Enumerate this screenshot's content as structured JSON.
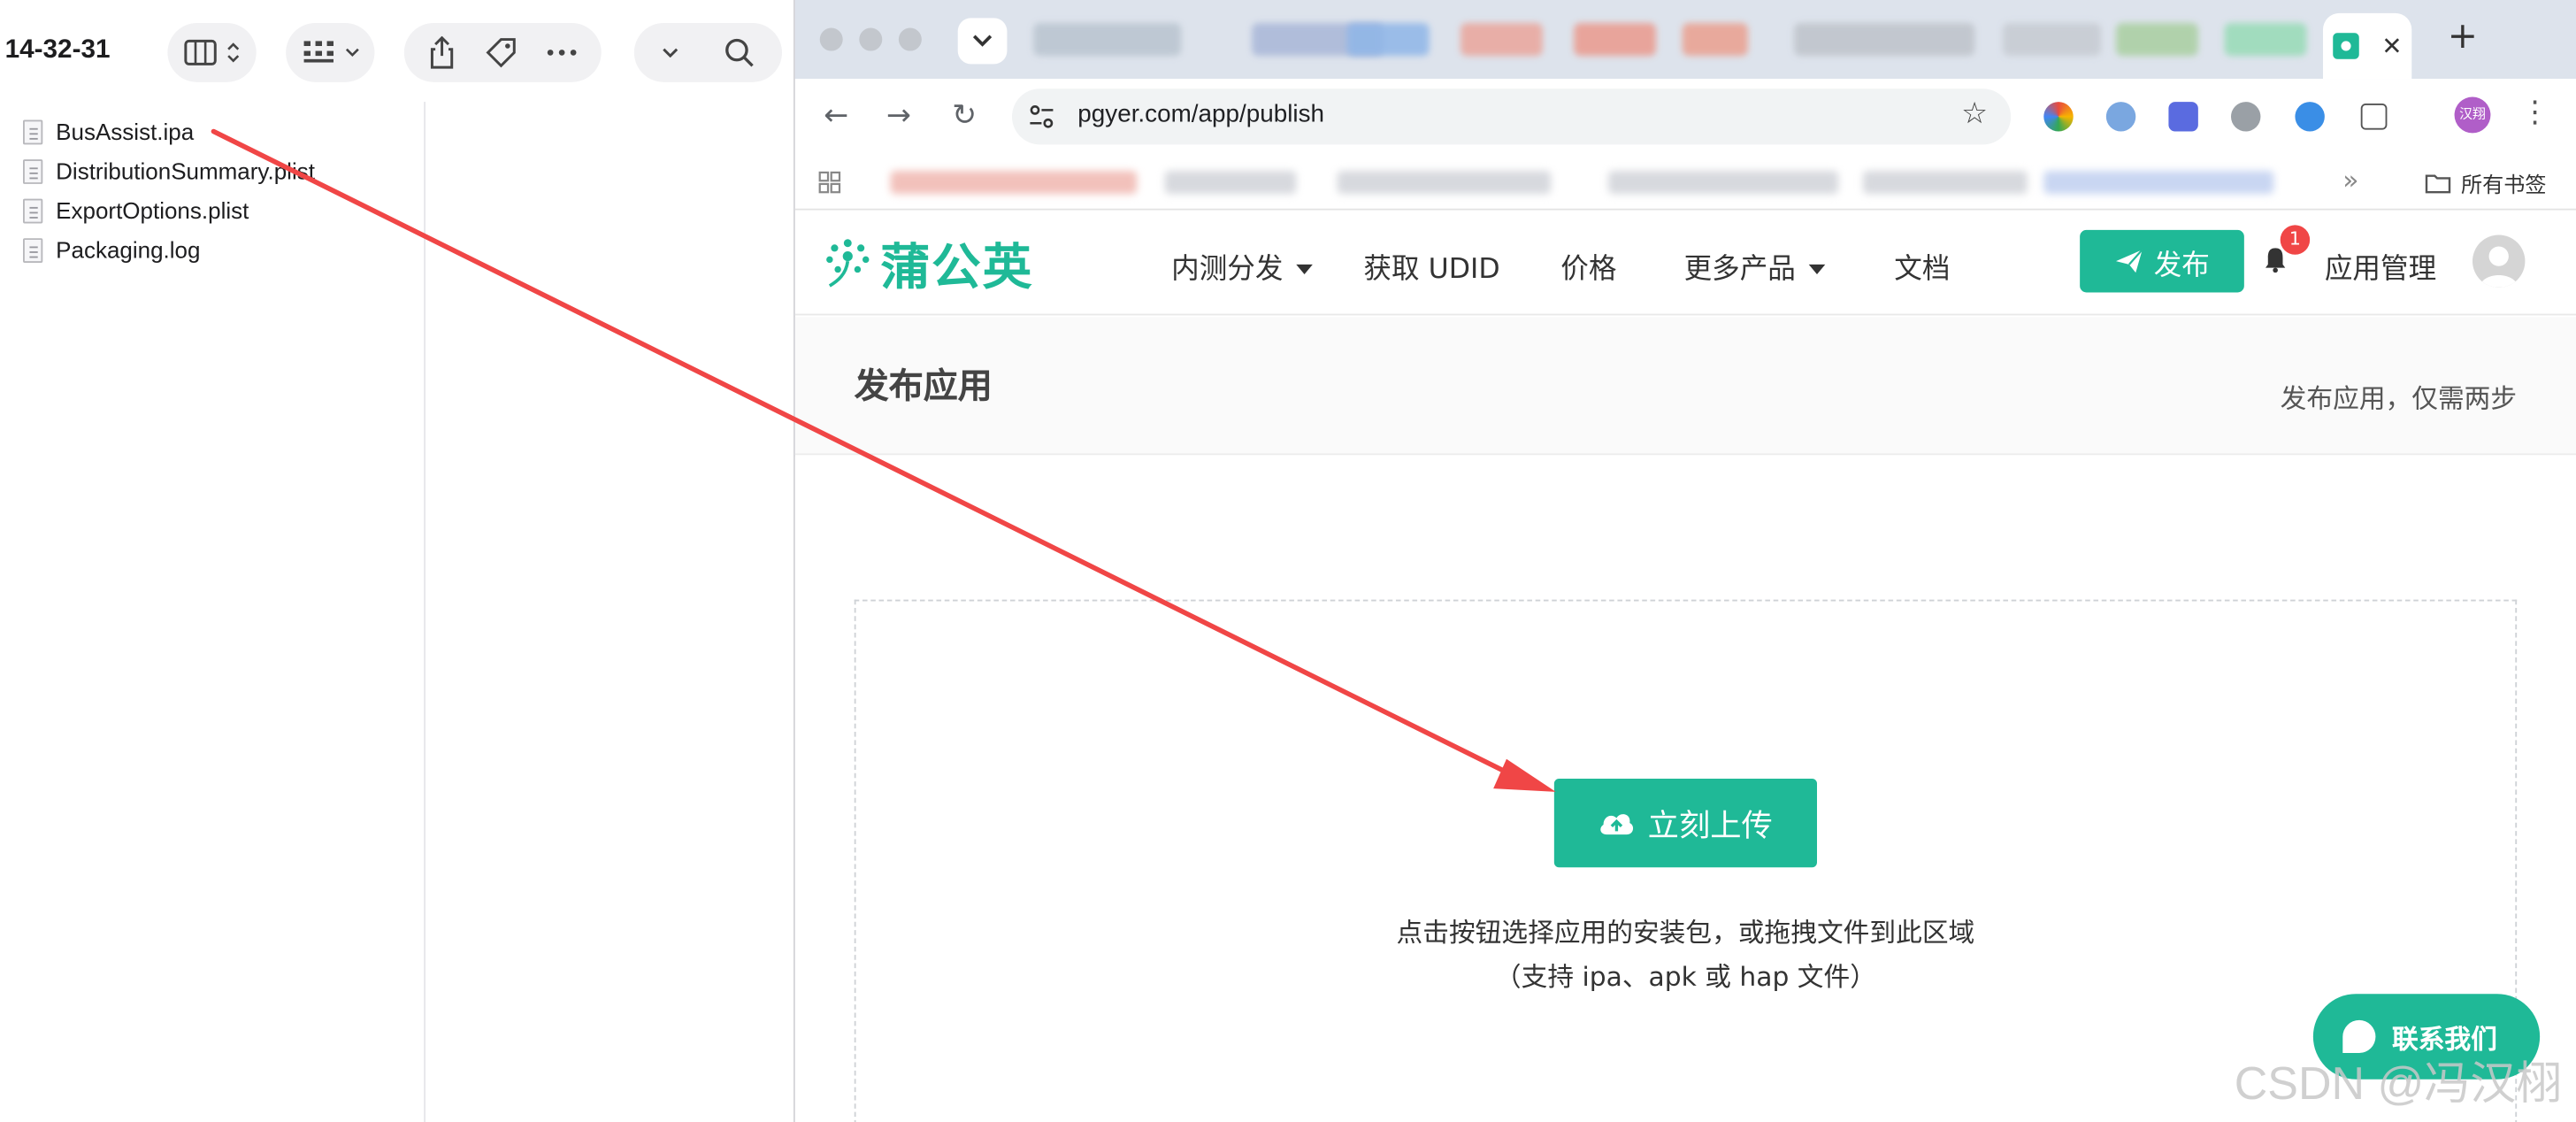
{
  "finder": {
    "title": "14-32-31",
    "files": [
      {
        "name": "BusAssist.ipa"
      },
      {
        "name": "DistributionSummary.plist"
      },
      {
        "name": "ExportOptions.plist"
      },
      {
        "name": "Packaging.log"
      }
    ]
  },
  "browser": {
    "url": "pgyer.com/app/publish",
    "avatar_initials": "汉翔",
    "all_bookmarks": "所有书签",
    "chevrons": "»"
  },
  "site": {
    "logo": "蒲公英",
    "nav": {
      "beta": "内测分发",
      "udid": "获取 UDID",
      "price": "价格",
      "more": "更多产品",
      "docs": "文档"
    },
    "publish_button": "发布",
    "notification_count": "1",
    "app_manage": "应用管理",
    "page_title": "发布应用",
    "page_subtitle": "发布应用，仅需两步",
    "upload_button": "立刻上传",
    "hint_line1": "点击按钮选择应用的安装包，或拖拽文件到此区域",
    "hint_line2": "（支持 ipa、apk 或 hap 文件）",
    "contact_button": "联系我们"
  },
  "watermark": "CSDN @冯汉栩",
  "colors": {
    "brand": "#1fb997",
    "badge": "#f04646",
    "annotation_arrow": "#f04646"
  }
}
